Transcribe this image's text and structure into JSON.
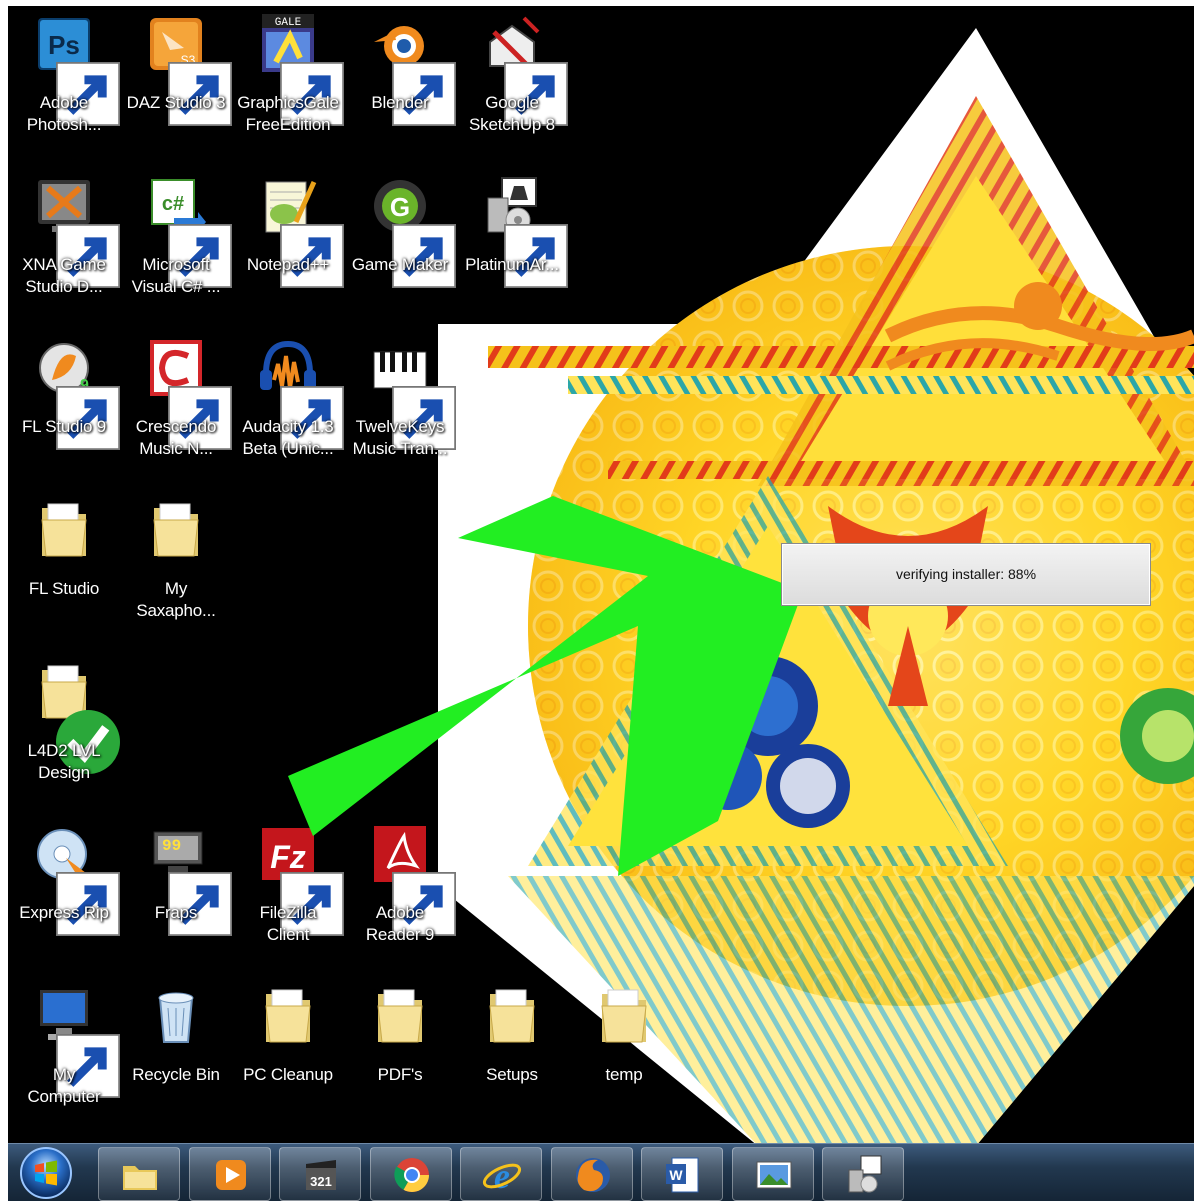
{
  "desktop": {
    "icons": [
      {
        "label": "Adobe\nPhotosh...",
        "icon": "photoshop-icon"
      },
      {
        "label": "DAZ Studio 3",
        "icon": "daz-studio-icon"
      },
      {
        "label": "GraphicsGale\nFreeEdition",
        "icon": "graphicsgale-icon"
      },
      {
        "label": "Blender",
        "icon": "blender-icon"
      },
      {
        "label": "Google\nSketchUp 8",
        "icon": "sketchup-icon"
      },
      {
        "label": "XNA Game\nStudio D...",
        "icon": "xna-icon"
      },
      {
        "label": "Microsoft\nVisual C# ...",
        "icon": "visual-csharp-icon"
      },
      {
        "label": "Notepad++",
        "icon": "notepadpp-icon"
      },
      {
        "label": "Game Maker",
        "icon": "game-maker-icon"
      },
      {
        "label": "PlatinumAr...",
        "icon": "platinum-arts-icon"
      },
      {
        "label": "FL Studio 9",
        "icon": "fl-studio-icon"
      },
      {
        "label": "Crescendo\nMusic N...",
        "icon": "crescendo-icon"
      },
      {
        "label": "Audacity 1.3\nBeta (Unic...",
        "icon": "audacity-icon"
      },
      {
        "label": "TwelveKeys\nMusic Tran...",
        "icon": "twelvekeys-icon"
      },
      {
        "label": "FL Studio",
        "icon": "folder-icon"
      },
      {
        "label": "My\nSaxapho...",
        "icon": "folder-icon"
      },
      {
        "label": "L4D2 LVL\nDesign",
        "icon": "folder-icon"
      },
      {
        "label": "Express Rip",
        "icon": "express-rip-icon"
      },
      {
        "label": "Fraps",
        "icon": "fraps-icon"
      },
      {
        "label": "FileZilla\nClient",
        "icon": "filezilla-icon"
      },
      {
        "label": "Adobe\nReader 9",
        "icon": "adobe-reader-icon"
      },
      {
        "label": "My\nComputer",
        "icon": "computer-icon"
      },
      {
        "label": "Recycle Bin",
        "icon": "recycle-bin-icon"
      },
      {
        "label": "PC Cleanup",
        "icon": "folder-icon"
      },
      {
        "label": "PDF's",
        "icon": "folder-icon"
      },
      {
        "label": "Setups",
        "icon": "folder-icon"
      },
      {
        "label": "temp",
        "icon": "folder-icon"
      }
    ]
  },
  "dialog": {
    "text": "verifying installer: 88%",
    "progress": 0.88
  },
  "annotation": {
    "color": "#22ee22",
    "icon": "green-arrow"
  },
  "taskbar": {
    "start_icon": "windows-start-orb",
    "items": [
      {
        "icon": "windows-explorer-icon"
      },
      {
        "icon": "media-player-icon"
      },
      {
        "icon": "media-center-icon"
      },
      {
        "icon": "chrome-icon"
      },
      {
        "icon": "internet-explorer-icon"
      },
      {
        "icon": "firefox-icon"
      },
      {
        "icon": "word-icon"
      },
      {
        "icon": "picture-viewer-icon"
      },
      {
        "icon": "installer-icon"
      }
    ]
  }
}
